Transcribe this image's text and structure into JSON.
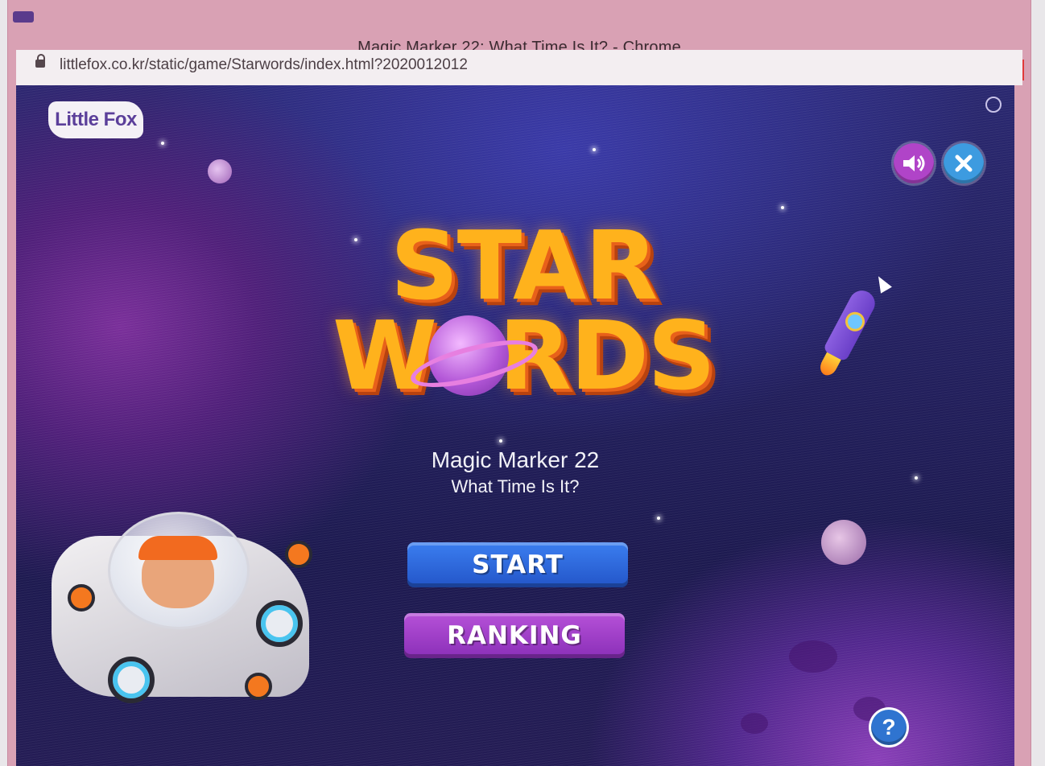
{
  "window": {
    "title": "Magic Marker 22: What Time Is It? - Chrome",
    "controls": {
      "minimize": "–",
      "maximize": "□",
      "close": "×"
    }
  },
  "address_bar": {
    "url": "littlefox.co.kr/static/game/Starwords/index.html?2020012012",
    "lock_icon": "lock-icon"
  },
  "game": {
    "logo_text": "Little Fox",
    "sound_icon": "speaker-icon",
    "close_icon": "close-icon",
    "title_line1": "STAR",
    "title_line2": "W  RDS",
    "lesson_title": "Magic Marker 22",
    "lesson_subtitle": "What Time Is It?",
    "buttons": {
      "start": "START",
      "ranking": "RANKING"
    },
    "help_label": "?",
    "colors": {
      "start_button": "#2f6be0",
      "ranking_button": "#a543cc",
      "title_fill": "#ffb21c",
      "background": "#23205e"
    }
  }
}
